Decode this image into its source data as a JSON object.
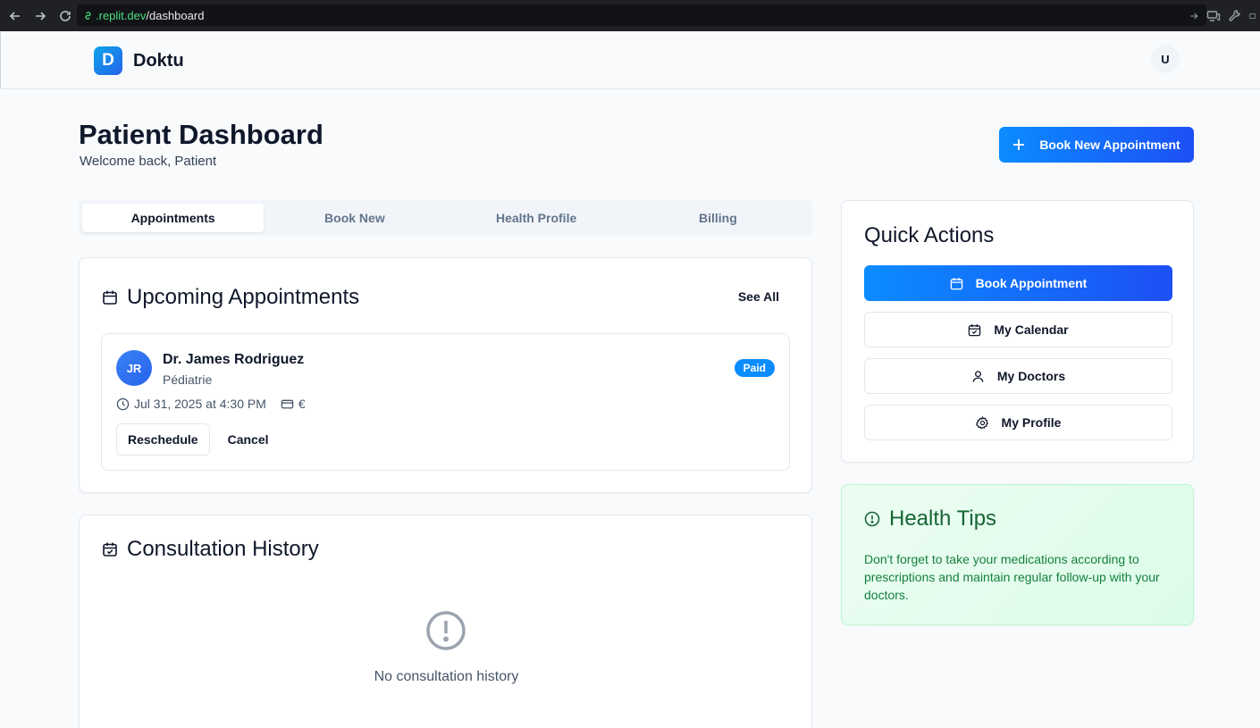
{
  "browser": {
    "url_domain": ".replit.dev",
    "url_path": "/dashboard"
  },
  "header": {
    "logo_letter": "D",
    "brand": "Doktu",
    "user_initial": "U"
  },
  "page": {
    "title": "Patient Dashboard",
    "subtitle": "Welcome back, Patient",
    "book_new_label": "Book New Appointment"
  },
  "tabs": [
    {
      "label": "Appointments",
      "active": true
    },
    {
      "label": "Book New",
      "active": false
    },
    {
      "label": "Health Profile",
      "active": false
    },
    {
      "label": "Billing",
      "active": false
    }
  ],
  "upcoming": {
    "title": "Upcoming Appointments",
    "see_all": "See All",
    "appointment": {
      "initials": "JR",
      "doctor": "Dr. James Rodriguez",
      "specialty": "Pédiatrie",
      "status": "Paid",
      "datetime": "Jul 31, 2025 at 4:30 PM",
      "price": "€",
      "reschedule": "Reschedule",
      "cancel": "Cancel"
    }
  },
  "history": {
    "title": "Consultation History",
    "empty_text": "No consultation history"
  },
  "quick_actions": {
    "title": "Quick Actions",
    "items": [
      {
        "label": "Book Appointment",
        "icon": "calendar-icon"
      },
      {
        "label": "My Calendar",
        "icon": "calendar-check-icon"
      },
      {
        "label": "My Doctors",
        "icon": "user-icon"
      },
      {
        "label": "My Profile",
        "icon": "gear-icon"
      }
    ]
  },
  "health_tips": {
    "title": "Health Tips",
    "text": "Don't forget to take your medications according to prescriptions and maintain regular follow-up with your doctors."
  },
  "colors": {
    "primary": "#0b8cff",
    "primary_end": "#1d4ff5",
    "tips_text": "#15803d"
  }
}
